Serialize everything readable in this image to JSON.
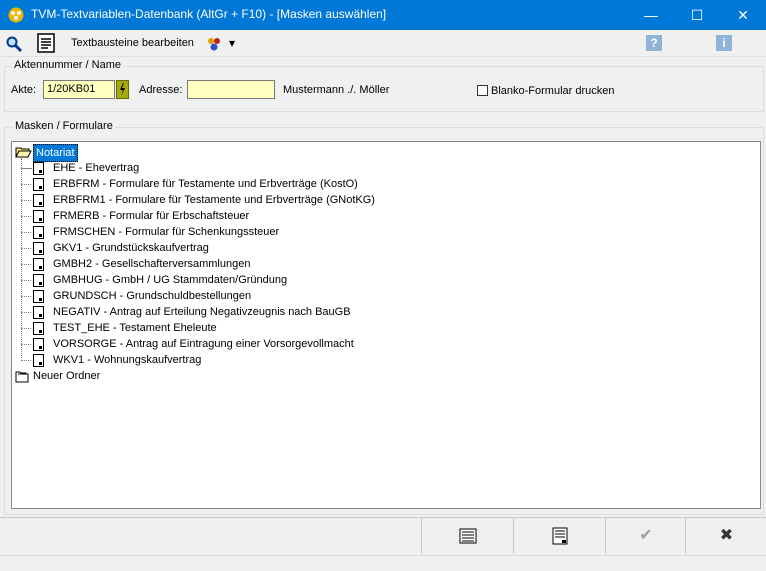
{
  "window": {
    "title": "TVM-Textvariablen-Datenbank (AltGr + F10) - [Masken auswählen]",
    "minimize": "—",
    "maximize": "☐",
    "close": "✕"
  },
  "toolbar": {
    "search_icon": "search-icon",
    "edit_icon": "document-list-icon",
    "edit_label": "Textbausteine bearbeiten",
    "users_icon": "users-icon",
    "dropdown_arrow": "▾",
    "help_icon": "?",
    "info_icon": "i",
    "accent_color": "#0078d7"
  },
  "aktennummer": {
    "group_label": "Aktennummer / Name",
    "akte_label": "Akte:",
    "akte_value": "1/20KB01",
    "adresse_label": "Adresse:",
    "adresse_value": "",
    "name_text": "Mustermann ./. Möller",
    "blanko_label": "Blanko-Formular drucken",
    "blanko_checked": false
  },
  "masken": {
    "group_label": "Masken / Formulare",
    "root_folder": "Notariat",
    "items": [
      "EHE - Ehevertrag",
      "ERBFRM -  Formulare für Testamente und Erbverträge (KostO)",
      "ERBFRM1 -  Formulare für Testamente und Erbverträge (GNotKG)",
      "FRMERB - Formular für Erbschaftsteuer",
      "FRMSCHEN - Formular für Schenkungssteuer",
      "GKV1 - Grundstückskaufvertrag",
      "GMBH2 - Gesellschafterversammlungen",
      "GMBHUG - GmbH / UG Stammdaten/Gründung",
      "GRUNDSCH - Grundschuldbestellungen",
      "NEGATIV - Antrag auf Erteilung Negativzeugnis nach BauGB",
      "TEST_EHE - Testament Eheleute",
      "VORSORGE - Antrag auf Eintragung einer Vorsorgevollmacht",
      "WKV1 - Wohnungskaufvertrag"
    ],
    "second_folder": "Neuer Ordner"
  },
  "buttons": {
    "list_icon": "list-icon",
    "document_icon": "document-icon",
    "ok_glyph": "✔",
    "cancel_glyph": "✖"
  }
}
